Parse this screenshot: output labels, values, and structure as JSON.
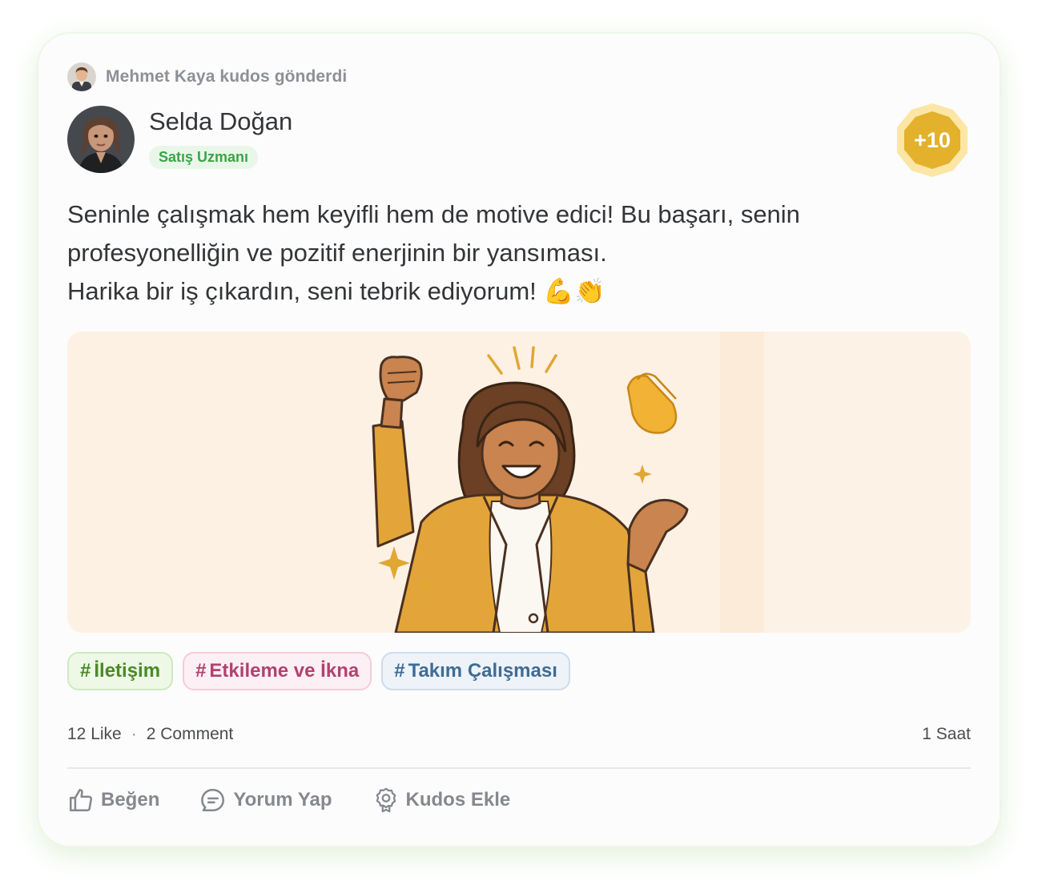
{
  "post": {
    "sender_text": "Mehmet Kaya kudos gönderdi",
    "recipient_name": "Selda Doğan",
    "recipient_role": "Satış Uzmanı",
    "points": "+10",
    "message_lines": [
      "Seninle çalışmak hem keyifli hem de motive edici! Bu başarı, senin",
      "profesyonelliğin ve pozitif enerjinin bir yansıması.",
      "Harika bir iş çıkardın, seni tebrik ediyorum! 💪👏"
    ],
    "tags": [
      {
        "hash": "#",
        "label": "İletişim"
      },
      {
        "hash": "#",
        "label": "Etkileme ve İkna"
      },
      {
        "hash": "#",
        "label": "Takım Çalışması"
      }
    ]
  },
  "stats": {
    "likes": "12 Like",
    "separator": "·",
    "comments": "2 Comment",
    "time": "1 Saat"
  },
  "actions": {
    "like": "Beğen",
    "comment": "Yorum Yap",
    "kudos": "Kudos Ekle"
  },
  "colors": {
    "points_badge": "#e3b12b",
    "role_badge_bg": "#e9f7e9",
    "role_badge_text": "#3aa449",
    "image_bg": "#fdf1e4"
  },
  "icons": {
    "like": "thumbs-up-icon",
    "comment": "comment-bubble-icon",
    "kudos": "award-badge-icon"
  }
}
